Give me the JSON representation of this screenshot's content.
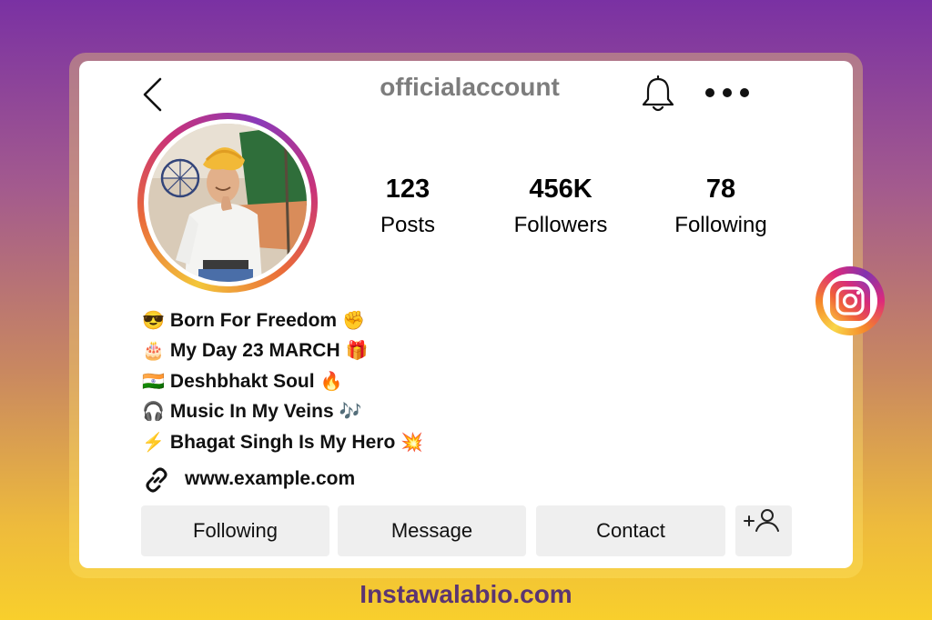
{
  "profile": {
    "username": "officialaccount",
    "stats": [
      {
        "value": "123",
        "label": "Posts"
      },
      {
        "value": "456K",
        "label": "Followers"
      },
      {
        "value": "78",
        "label": "Following"
      }
    ],
    "bio": [
      {
        "emoji_before": "😎",
        "text": "Born For Freedom",
        "emoji_after": "✊"
      },
      {
        "emoji_before": "🎂",
        "text": "My Day 23 MARCH",
        "emoji_after": "🎁"
      },
      {
        "emoji_before": "🇮🇳",
        "text": "Deshbhakt Soul",
        "emoji_after": "🔥"
      },
      {
        "emoji_before": "🎧",
        "text": "Music In My Veins",
        "emoji_after": "🎶"
      },
      {
        "emoji_before": "⚡",
        "text": "Bhagat Singh Is My Hero",
        "emoji_after": "💥"
      }
    ],
    "link": "www.example.com"
  },
  "actions": {
    "following": "Following",
    "message": "Message",
    "contact": "Contact"
  },
  "icons": [
    "back-icon",
    "bell-icon",
    "more-icon",
    "instagram-icon",
    "link-icon",
    "add-user-icon"
  ],
  "watermark": "Instawalabio.com",
  "colors": {
    "gradient_top": "#7a31a3",
    "gradient_bottom": "#f8cf2c",
    "username_gray": "#7d7d7d",
    "button_bg": "#efefef",
    "watermark": "#5b3572"
  }
}
